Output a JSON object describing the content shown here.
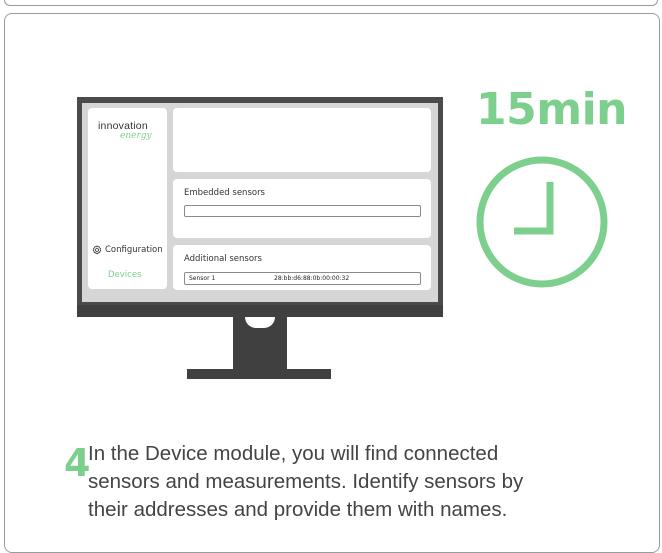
{
  "timer": {
    "label": "15min",
    "icon": "clock-icon"
  },
  "app": {
    "logo": {
      "primary": "innovation",
      "secondary": "energy"
    },
    "sidebar": {
      "configuration_label": "Configuration",
      "configuration_icon": "gear-icon",
      "devices_label": "Devices"
    },
    "embedded_sensors": {
      "title": "Embedded sensors",
      "value": ""
    },
    "additional_sensors": {
      "title": "Additional sensors",
      "rows": [
        {
          "name": "Sensor 1",
          "address": "28:bb:d6:88:0b:00:00:32"
        }
      ]
    }
  },
  "step": {
    "number": "4",
    "lines": [
      "In the Device module, you will find connected",
      "sensors and measurements. Identify sensors by",
      "their addresses and provide them with names."
    ]
  },
  "colors": {
    "accent": "#7ccf8c",
    "bezel": "#4b4b4b",
    "screen_bg": "#d6d6d6"
  }
}
